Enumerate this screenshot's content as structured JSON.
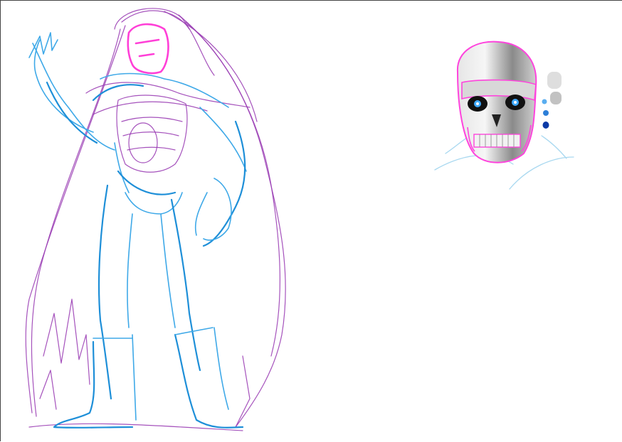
{
  "canvas": {
    "background": "#ffffff",
    "border_color": "#444444"
  },
  "sketch": {
    "figure": {
      "line_colors": [
        "#3fa9e8",
        "#1e8fd8",
        "#9b3fb5",
        "#ff3fd7"
      ]
    },
    "skull_head": {
      "fill_colors": [
        "#c8c8c8",
        "#f0f0f0",
        "#ff44dd"
      ],
      "eye_color": "#3fa9ff"
    },
    "swatches": [
      "#d9d9d9",
      "#bdbdbd",
      "#5aaef0",
      "#2d7fd8",
      "#0b3aa6"
    ]
  }
}
